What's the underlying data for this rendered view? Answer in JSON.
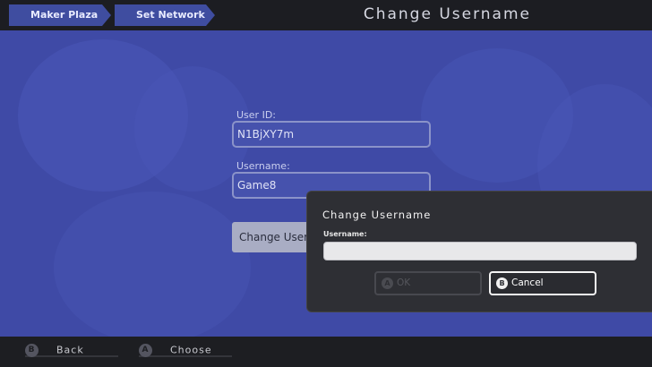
{
  "breadcrumbs": [
    "Maker Plaza",
    "Set Network"
  ],
  "page_title": "Change Username",
  "form": {
    "user_id_label": "User ID:",
    "user_id_value": "N1BjXY7m",
    "username_label": "Username:",
    "username_value": "Game8",
    "change_button_label": "Change Userna"
  },
  "dialog": {
    "title": "Change Username",
    "field_label": "Username:",
    "field_value": "",
    "ok_key": "A",
    "ok_label": "OK",
    "cancel_key": "B",
    "cancel_label": "Cancel"
  },
  "footer": {
    "back_key": "B",
    "back_label": "Back",
    "choose_key": "A",
    "choose_label": "Choose"
  },
  "colors": {
    "background_blue": "#3f4aa6",
    "crumb_blue": "#3f4da0",
    "dialog_bg": "#2e2f34"
  }
}
